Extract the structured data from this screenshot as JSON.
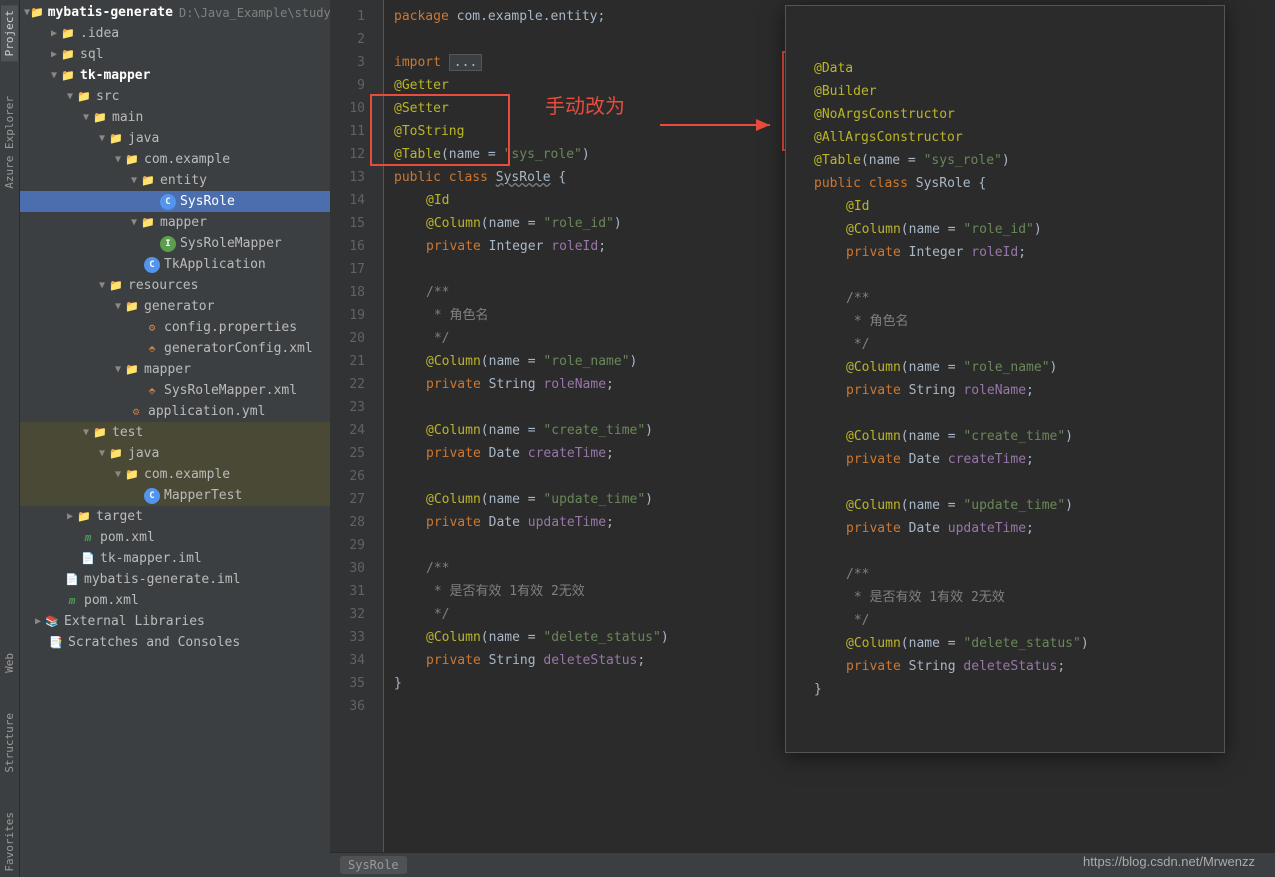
{
  "vtabs": [
    "Project",
    "Azure Explorer",
    "Web",
    "Structure",
    "Favorites"
  ],
  "project": {
    "root": "mybatis-generate",
    "rootPath": "D:\\Java_Example\\study\\myb",
    "tree": {
      "idea": ".idea",
      "sql": "sql",
      "tkmapper": "tk-mapper",
      "src": "src",
      "main": "main",
      "java": "java",
      "pkg": "com.example",
      "entity": "entity",
      "sysrole": "SysRole",
      "mapper": "mapper",
      "srmapper": "SysRoleMapper",
      "tkapp": "TkApplication",
      "resources": "resources",
      "generator": "generator",
      "cfgprop": "config.properties",
      "gencfg": "generatorConfig.xml",
      "mapper2": "mapper",
      "srmapperxml": "SysRoleMapper.xml",
      "appyml": "application.yml",
      "test": "test",
      "java2": "java",
      "pkg2": "com.example",
      "maptest": "MapperTest",
      "target": "target",
      "pom": "pom.xml",
      "tkmapperiml": "tk-mapper.iml",
      "mybgeniml": "mybatis-generate.iml",
      "pom2": "pom.xml",
      "extlibs": "External Libraries",
      "scratches": "Scratches and Consoles"
    }
  },
  "editor": {
    "lineNumbers": [
      "1",
      "2",
      "3",
      "9",
      "10",
      "11",
      "12",
      "13",
      "14",
      "15",
      "16",
      "17",
      "18",
      "19",
      "20",
      "21",
      "22",
      "23",
      "24",
      "25",
      "26",
      "27",
      "28",
      "29",
      "30",
      "31",
      "32",
      "33",
      "34",
      "35",
      "36"
    ],
    "package": "com.example.entity",
    "import_kw": "import",
    "import_dots": "...",
    "getter": "@Getter",
    "setter": "@Setter",
    "tostring": "@ToString",
    "table": "@Table",
    "name_eq": "name = ",
    "tablename": "\"sys_role\"",
    "public": "public",
    "class": "class",
    "classname": "SysRole",
    "id": "@Id",
    "column": "@Column",
    "roleid_col": "\"role_id\"",
    "private": "private",
    "Integer": "Integer",
    "roleId": "roleId",
    "c1": "/**",
    "c2": " * 角色名",
    "c3": " */",
    "rolename_col": "\"role_name\"",
    "String": "String",
    "roleName": "roleName",
    "createtime_col": "\"create_time\"",
    "Date": "Date",
    "createTime": "createTime",
    "updatetime_col": "\"update_time\"",
    "updateTime": "updateTime",
    "c4": " * 是否有效  1有效  2无效",
    "deletestatus_col": "\"delete_status\"",
    "deleteStatus": "deleteStatus"
  },
  "annotation": {
    "label": "手动改为"
  },
  "popup": {
    "data": "@Data",
    "builder": "@Builder",
    "noargs": "@NoArgsConstructor",
    "allargs": "@AllArgsConstructor",
    "table": "@Table",
    "name_eq": "name = ",
    "tablename": "\"sys_role\"",
    "public": "public",
    "class": "class",
    "classname": "SysRole",
    "id": "@Id",
    "column": "@Column",
    "roleid_col": "\"role_id\"",
    "private": "private",
    "Integer": "Integer",
    "roleId": "roleId",
    "c1": "/**",
    "c2": " * 角色名",
    "c3": " */",
    "c4": " * 是否有效  1有效  2无效",
    "rolename_col": "\"role_name\"",
    "String": "String",
    "roleName": "roleName",
    "createtime_col": "\"create_time\"",
    "Date": "Date",
    "createTime": "createTime",
    "updatetime_col": "\"update_time\"",
    "updateTime": "updateTime",
    "deletestatus_col": "\"delete_status\"",
    "deleteStatus": "deleteStatus"
  },
  "breadcrumb": "SysRole",
  "watermark": "https://blog.csdn.net/Mrwenzz"
}
